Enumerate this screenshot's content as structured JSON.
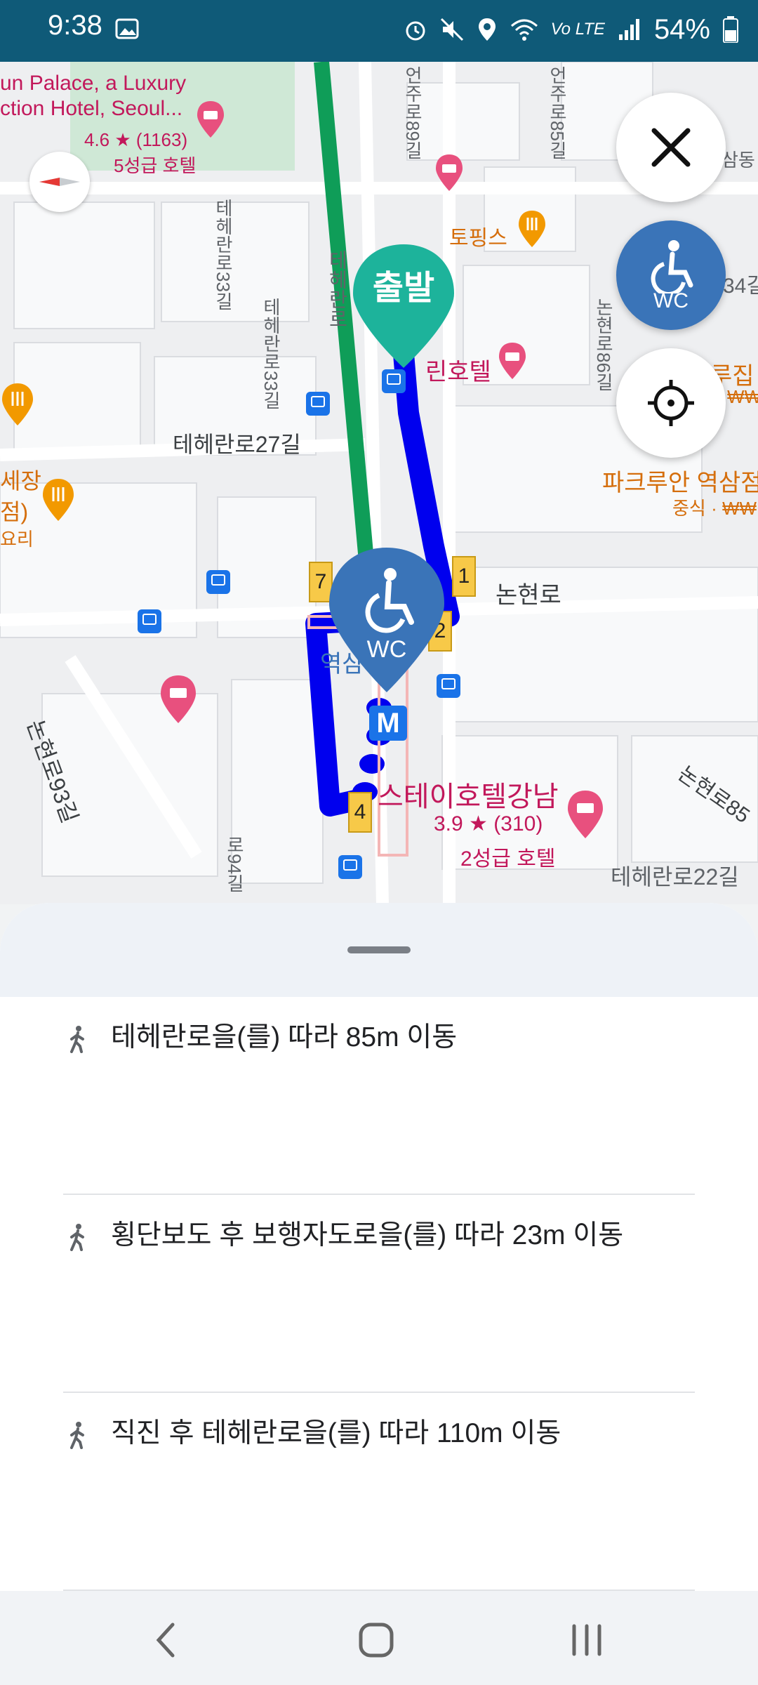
{
  "status_bar": {
    "time": "9:38",
    "network": "Vo LTE",
    "battery": "54%"
  },
  "map": {
    "labels": {
      "hotel_top_line1": "un Palace, a Luxury",
      "hotel_top_line2": "ction Hotel, Seoul...",
      "hotel_top_rating": "4.6 ★ (1163)",
      "hotel_top_class": "5성급 호텔",
      "eonju89": "언주로89길",
      "eonju85": "언주로85길",
      "samdong": "삼동",
      "toppings": "토핑스",
      "teheran33a": "테헤란로33길",
      "teheran_main": "테헤란로",
      "teheran33b": "테헤란로33길",
      "nonhyeon86": "논현로86길",
      "linhotel": "린호텔",
      "r34": "34길",
      "rujip": "루집",
      "won": "₩₩",
      "teheran27": "테헤란로27길",
      "parkroo": "파크루안 역삼점",
      "chinese": "중식 · ₩₩",
      "left_jang": "세장",
      "left_jeom": "점)",
      "left_yori": "요리",
      "nonhyeonro": "논현로",
      "yeoksam": "역삼",
      "nonhyeon93": "논현로93길",
      "stayhotel": "스테이호텔강남",
      "stayhotel_rating": "3.9 ★ (310)",
      "stayhotel_class": "2성급 호텔",
      "nonhyeon85": "논현로85",
      "teheran22": "테헤란로22길",
      "r94": "로94길"
    },
    "start_marker": "출발",
    "wc_label": "WC",
    "metro_label": "M",
    "exits": [
      "1",
      "2",
      "4",
      "7"
    ]
  },
  "buttons": {
    "wc_label": "WC"
  },
  "steps": [
    {
      "text": "테헤란로을(를) 따라 85m 이동"
    },
    {
      "text": "횡단보도 후 보행자도로을(를) 따라 23m 이동"
    },
    {
      "text": "직진 후 테헤란로을(를) 따라 110m 이동"
    }
  ],
  "colors": {
    "route_blue": "#0000ee",
    "route_green": "#0f9d58",
    "accent_blue": "#3a74b8",
    "start_teal": "#1db39b",
    "status_bar": "#0f5a78"
  }
}
